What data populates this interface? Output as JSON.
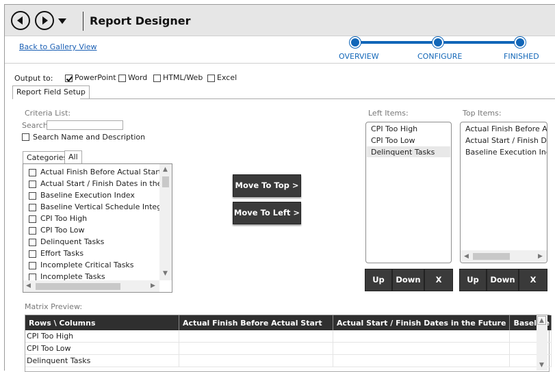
{
  "header": {
    "title": "Report Designer"
  },
  "nav": {
    "back_link": "Back to Gallery View"
  },
  "steps": [
    "OVERVIEW",
    "CONFIGURE",
    "FINISHED"
  ],
  "output": {
    "label": "Output to:",
    "options": [
      {
        "label": "PowerPoint",
        "checked": true
      },
      {
        "label": "Word",
        "checked": false
      },
      {
        "label": "HTML/Web",
        "checked": false
      },
      {
        "label": "Excel",
        "checked": false
      }
    ]
  },
  "tabs": {
    "report_field_setup": "Report Field Setup",
    "categories": "Categories",
    "all": "All"
  },
  "criteria": {
    "title": "Criteria List:",
    "search_label": "Search:",
    "search_value": "",
    "search_name_desc": "Search Name and Description",
    "items": [
      "Actual Finish Before Actual Start",
      "Actual Start / Finish Dates in the Future",
      "Baseline Execution Index",
      "Baseline Vertical Schedule Integration",
      "CPI Too High",
      "CPI Too Low",
      "Delinquent Tasks",
      "Effort Tasks",
      "Incomplete Critical Tasks",
      "Incomplete Tasks"
    ]
  },
  "buttons": {
    "move_to_top": "Move To Top >",
    "move_to_left": "Move To Left >",
    "up": "Up",
    "down": "Down",
    "remove": "X"
  },
  "left_items": {
    "title": "Left Items:",
    "items": [
      "CPI Too High",
      "CPI Too Low",
      "Delinquent Tasks"
    ]
  },
  "top_items": {
    "title": "Top Items:",
    "items": [
      "Actual Finish Before Actual Start",
      "Actual Start / Finish Dates in the Future",
      "Baseline Execution Index"
    ]
  },
  "matrix": {
    "title": "Matrix Preview:",
    "columns": [
      "Rows \\ Columns",
      "Actual Finish Before Actual Start",
      "Actual Start / Finish Dates in the Future",
      "Baseline Execution Index"
    ],
    "rows": [
      "CPI Too High",
      "CPI Too Low",
      "Delinquent Tasks"
    ]
  },
  "colors": {
    "accent": "#1166b8",
    "button_dark": "#3a3a3a",
    "header_bg": "#2f2f2f"
  }
}
